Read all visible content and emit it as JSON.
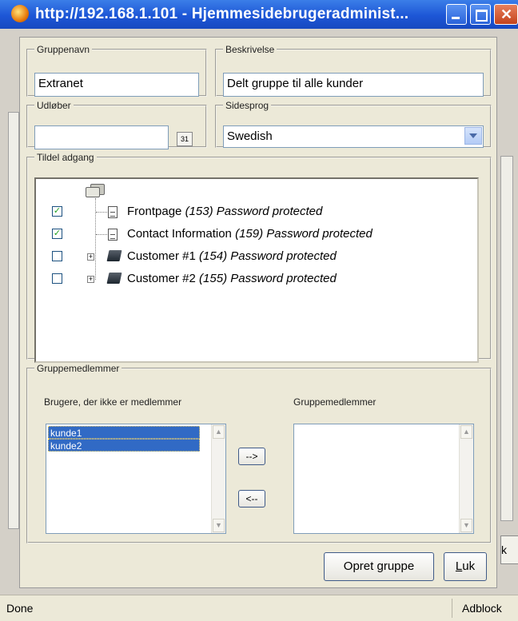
{
  "window": {
    "title": "http://192.168.1.101 - Hjemmesidebrugeradminist...",
    "close_glyph": "✕"
  },
  "form": {
    "group_name": {
      "legend": "Gruppenavn",
      "value": "Extranet"
    },
    "description": {
      "legend": "Beskrivelse",
      "value": "Delt gruppe til alle kunder"
    },
    "expires": {
      "legend": "Udløber",
      "value": "",
      "calendar_label": "31"
    },
    "site_language": {
      "legend": "Sidesprog",
      "selected": "Swedish"
    }
  },
  "access": {
    "legend": "Tildel adgang",
    "items": [
      {
        "name": "Frontpage",
        "id": "(153)",
        "status": "Password protected",
        "checked": true,
        "icon": "page-icon"
      },
      {
        "name": "Contact Information",
        "id": "(159)",
        "status": "Password protected",
        "checked": true,
        "icon": "page-icon"
      },
      {
        "name": "Customer #1",
        "id": "(154)",
        "status": "Password protected",
        "checked": false,
        "icon": "book-icon"
      },
      {
        "name": "Customer #2",
        "id": "(155)",
        "status": "Password protected",
        "checked": false,
        "icon": "book-icon"
      }
    ],
    "check_glyph": "✓"
  },
  "members": {
    "legend": "Gruppemedlemmer",
    "non_members_label": "Brugere, der ikke er medlemmer",
    "members_label": "Gruppemedlemmer",
    "non_members": [
      "kunde1",
      "kunde2"
    ],
    "add_button": "-->",
    "remove_button": "<--"
  },
  "buttons": {
    "create": "Opret gruppe",
    "close_prefix": "L",
    "close_rest": "uk"
  },
  "background": {
    "partial_button": "k"
  },
  "statusbar": {
    "left": "Done",
    "right": "Adblock"
  }
}
